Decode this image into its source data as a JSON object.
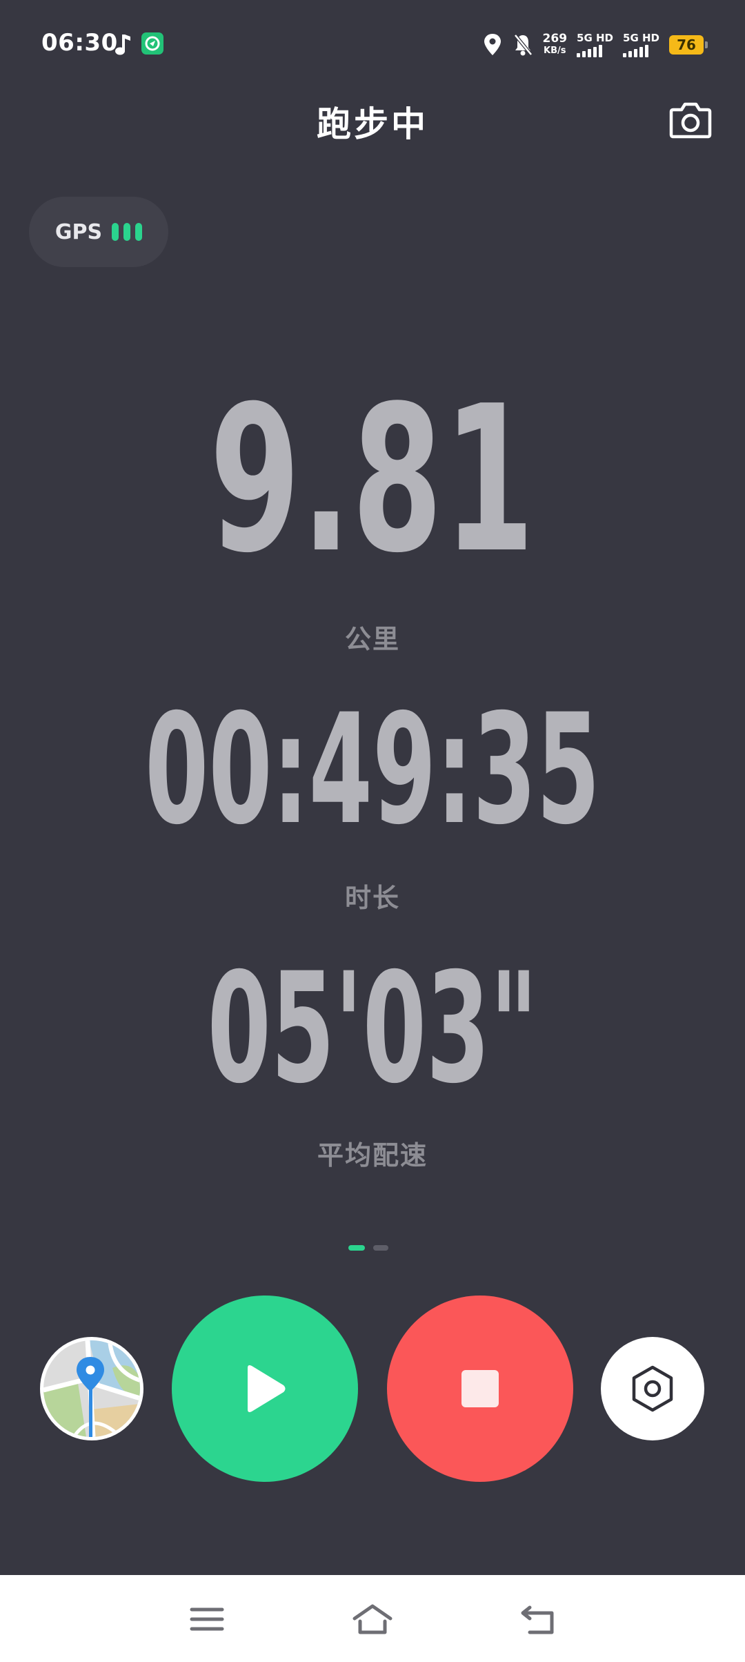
{
  "status_bar": {
    "time": "06:30",
    "net_speed_value": "269",
    "net_speed_unit": "KB/s",
    "sim1_label": "5G HD",
    "sim2_label": "5G HD",
    "battery": "76",
    "icons": [
      "music-note-icon",
      "app-notification-icon",
      "location-icon",
      "bell-muted-icon",
      "signal-icon",
      "battery-icon"
    ]
  },
  "header": {
    "title": "跑步中",
    "camera_icon": "camera-icon"
  },
  "gps": {
    "label": "GPS",
    "signal_level": 3,
    "signal_max": 3,
    "color": "#2bd48e"
  },
  "stats": {
    "distance": {
      "value": "9.81",
      "label": "公里"
    },
    "duration": {
      "value": "00:49:35",
      "label": "时长"
    },
    "pace": {
      "value": "05'03\"",
      "label": "平均配速"
    }
  },
  "pager": {
    "current": 1,
    "total": 2
  },
  "controls": {
    "map_icon": "map-icon",
    "play_icon": "play-icon",
    "stop_icon": "stop-icon",
    "settings_icon": "settings-hexagon-icon",
    "play_color": "#2cd58f",
    "stop_color": "#fb5758"
  },
  "nav_bar": {
    "icons": [
      "menu-icon",
      "home-icon",
      "back-icon"
    ]
  }
}
